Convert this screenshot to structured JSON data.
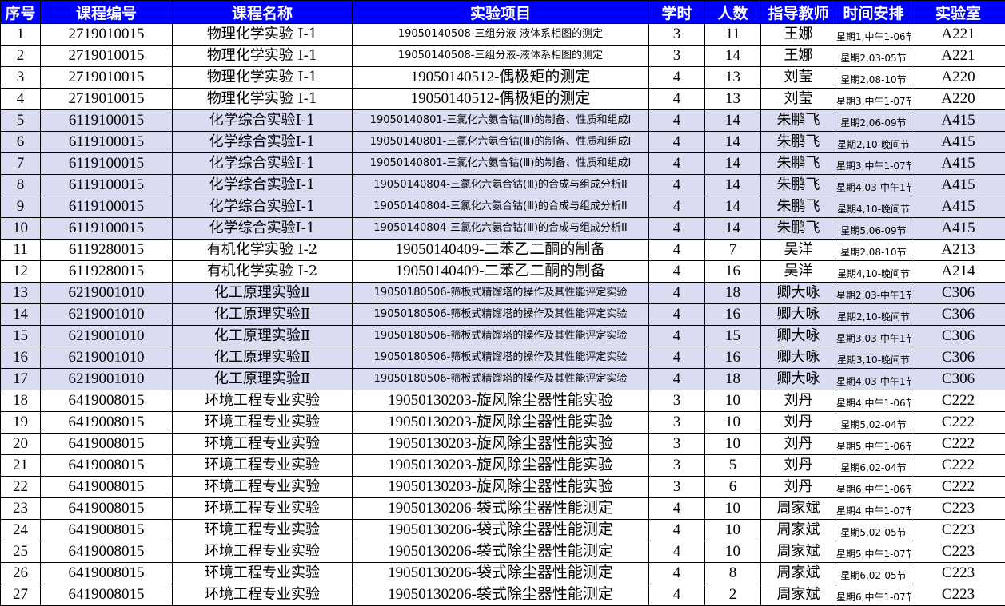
{
  "header": [
    "序号",
    "课程编号",
    "课程名称",
    "实验项目",
    "学时",
    "人数",
    "指导教师",
    "时间安排",
    "实验室"
  ],
  "colors": {
    "header_bg": "#0000ff",
    "header_text": "#ffffff",
    "band": "#dadcf2",
    "grid": "#000000"
  },
  "rows": [
    {
      "no": "1",
      "code": "2719010015",
      "course": "物理化学实验 Ⅰ-1",
      "project": "19050140508-三组分液-液体系相图的测定",
      "hours": "3",
      "count": "11",
      "teacher": "王娜",
      "time": "星期1,中午1-06节",
      "room": "A221",
      "band": false,
      "small": true
    },
    {
      "no": "2",
      "code": "2719010015",
      "course": "物理化学实验 Ⅰ-1",
      "project": "19050140508-三组分液-液体系相图的测定",
      "hours": "3",
      "count": "14",
      "teacher": "王娜",
      "time": "星期2,03-05节",
      "room": "A221",
      "band": false,
      "small": true
    },
    {
      "no": "3",
      "code": "2719010015",
      "course": "物理化学实验 Ⅰ-1",
      "project": "19050140512-偶极矩的测定",
      "hours": "4",
      "count": "13",
      "teacher": "刘莹",
      "time": "星期2,08-10节",
      "room": "A220",
      "band": false,
      "small": false
    },
    {
      "no": "4",
      "code": "2719010015",
      "course": "物理化学实验 Ⅰ-1",
      "project": "19050140512-偶极矩的测定",
      "hours": "4",
      "count": "13",
      "teacher": "刘莹",
      "time": "星期3,中午1-07节",
      "room": "A220",
      "band": false,
      "small": false
    },
    {
      "no": "5",
      "code": "6119100015",
      "course": "化学综合实验Ⅰ-1",
      "project": "19050140801-三氯化六氨合钴(Ⅲ)的制备、性质和组成I",
      "hours": "4",
      "count": "14",
      "teacher": "朱鹏飞",
      "time": "星期2,06-09节",
      "room": "A415",
      "band": true,
      "small": true
    },
    {
      "no": "6",
      "code": "6119100015",
      "course": "化学综合实验Ⅰ-1",
      "project": "19050140801-三氯化六氨合钴(Ⅲ)的制备、性质和组成I",
      "hours": "4",
      "count": "14",
      "teacher": "朱鹏飞",
      "time": "星期2,10-晚间节",
      "room": "A415",
      "band": true,
      "small": true
    },
    {
      "no": "7",
      "code": "6119100015",
      "course": "化学综合实验Ⅰ-1",
      "project": "19050140801-三氯化六氨合钴(Ⅲ)的制备、性质和组成I",
      "hours": "4",
      "count": "14",
      "teacher": "朱鹏飞",
      "time": "星期3,中午1-07节",
      "room": "A415",
      "band": true,
      "small": true
    },
    {
      "no": "8",
      "code": "6119100015",
      "course": "化学综合实验Ⅰ-1",
      "project": "19050140804-三氯化六氨合钴(Ⅲ)的合成与组成分析II",
      "hours": "4",
      "count": "14",
      "teacher": "朱鹏飞",
      "time": "星期4,03-中午1节",
      "room": "A415",
      "band": true,
      "small": true
    },
    {
      "no": "9",
      "code": "6119100015",
      "course": "化学综合实验Ⅰ-1",
      "project": "19050140804-三氯化六氨合钴(Ⅲ)的合成与组成分析II",
      "hours": "4",
      "count": "14",
      "teacher": "朱鹏飞",
      "time": "星期4,10-晚间节",
      "room": "A415",
      "band": true,
      "small": true
    },
    {
      "no": "10",
      "code": "6119100015",
      "course": "化学综合实验Ⅰ-1",
      "project": "19050140804-三氯化六氨合钴(Ⅲ)的合成与组成分析II",
      "hours": "4",
      "count": "14",
      "teacher": "朱鹏飞",
      "time": "星期5,06-09节",
      "room": "A415",
      "band": true,
      "small": true
    },
    {
      "no": "11",
      "code": "6119280015",
      "course": "有机化学实验 Ⅰ-2",
      "project": "19050140409-二苯乙二酮的制备",
      "hours": "4",
      "count": "7",
      "teacher": "吴洋",
      "time": "星期2,08-10节",
      "room": "A213",
      "band": false,
      "small": false
    },
    {
      "no": "12",
      "code": "6119280015",
      "course": "有机化学实验 Ⅰ-2",
      "project": "19050140409-二苯乙二酮的制备",
      "hours": "4",
      "count": "16",
      "teacher": "吴洋",
      "time": "星期4,10-晚间节",
      "room": "A214",
      "band": false,
      "small": false
    },
    {
      "no": "13",
      "code": "6219001010",
      "course": "化工原理实验Ⅱ",
      "project": "19050180506-筛板式精馏塔的操作及其性能评定实验",
      "hours": "4",
      "count": "18",
      "teacher": "卿大咏",
      "time": "星期2,03-中午1节",
      "room": "C306",
      "band": true,
      "small": true
    },
    {
      "no": "14",
      "code": "6219001010",
      "course": "化工原理实验Ⅱ",
      "project": "19050180506-筛板式精馏塔的操作及其性能评定实验",
      "hours": "4",
      "count": "16",
      "teacher": "卿大咏",
      "time": "星期2,10-晚间节",
      "room": "C306",
      "band": true,
      "small": true
    },
    {
      "no": "15",
      "code": "6219001010",
      "course": "化工原理实验Ⅱ",
      "project": "19050180506-筛板式精馏塔的操作及其性能评定实验",
      "hours": "4",
      "count": "15",
      "teacher": "卿大咏",
      "time": "星期3,03-中午1节",
      "room": "C306",
      "band": true,
      "small": true
    },
    {
      "no": "16",
      "code": "6219001010",
      "course": "化工原理实验Ⅱ",
      "project": "19050180506-筛板式精馏塔的操作及其性能评定实验",
      "hours": "4",
      "count": "16",
      "teacher": "卿大咏",
      "time": "星期3,10-晚间节",
      "room": "C306",
      "band": true,
      "small": true
    },
    {
      "no": "17",
      "code": "6219001010",
      "course": "化工原理实验Ⅱ",
      "project": "19050180506-筛板式精馏塔的操作及其性能评定实验",
      "hours": "4",
      "count": "18",
      "teacher": "卿大咏",
      "time": "星期4,03-中午1节",
      "room": "C306",
      "band": true,
      "small": true
    },
    {
      "no": "18",
      "code": "6419008015",
      "course": "环境工程专业实验",
      "project": "19050130203-旋风除尘器性能实验",
      "hours": "3",
      "count": "10",
      "teacher": "刘丹",
      "time": "星期4,中午1-06节",
      "room": "C222",
      "band": false,
      "small": false
    },
    {
      "no": "19",
      "code": "6419008015",
      "course": "环境工程专业实验",
      "project": "19050130203-旋风除尘器性能实验",
      "hours": "3",
      "count": "10",
      "teacher": "刘丹",
      "time": "星期5,02-04节",
      "room": "C222",
      "band": false,
      "small": false
    },
    {
      "no": "20",
      "code": "6419008015",
      "course": "环境工程专业实验",
      "project": "19050130203-旋风除尘器性能实验",
      "hours": "3",
      "count": "10",
      "teacher": "刘丹",
      "time": "星期5,中午1-06节",
      "room": "C222",
      "band": false,
      "small": false
    },
    {
      "no": "21",
      "code": "6419008015",
      "course": "环境工程专业实验",
      "project": "19050130203-旋风除尘器性能实验",
      "hours": "3",
      "count": "5",
      "teacher": "刘丹",
      "time": "星期6,02-04节",
      "room": "C222",
      "band": false,
      "small": false
    },
    {
      "no": "22",
      "code": "6419008015",
      "course": "环境工程专业实验",
      "project": "19050130203-旋风除尘器性能实验",
      "hours": "3",
      "count": "6",
      "teacher": "刘丹",
      "time": "星期6,中午1-06节",
      "room": "C222",
      "band": false,
      "small": false
    },
    {
      "no": "23",
      "code": "6419008015",
      "course": "环境工程专业实验",
      "project": "19050130206-袋式除尘器性能测定",
      "hours": "4",
      "count": "10",
      "teacher": "周家斌",
      "time": "星期4,中午1-07节",
      "room": "C223",
      "band": false,
      "small": false
    },
    {
      "no": "24",
      "code": "6419008015",
      "course": "环境工程专业实验",
      "project": "19050130206-袋式除尘器性能测定",
      "hours": "4",
      "count": "10",
      "teacher": "周家斌",
      "time": "星期5,02-05节",
      "room": "C223",
      "band": false,
      "small": false
    },
    {
      "no": "25",
      "code": "6419008015",
      "course": "环境工程专业实验",
      "project": "19050130206-袋式除尘器性能测定",
      "hours": "4",
      "count": "10",
      "teacher": "周家斌",
      "time": "星期5,中午1-07节",
      "room": "C223",
      "band": false,
      "small": false
    },
    {
      "no": "26",
      "code": "6419008015",
      "course": "环境工程专业实验",
      "project": "19050130206-袋式除尘器性能测定",
      "hours": "4",
      "count": "8",
      "teacher": "周家斌",
      "time": "星期6,02-05节",
      "room": "C223",
      "band": false,
      "small": false
    },
    {
      "no": "27",
      "code": "6419008015",
      "course": "环境工程专业实验",
      "project": "19050130206-袋式除尘器性能测定",
      "hours": "4",
      "count": "2",
      "teacher": "周家斌",
      "time": "星期6,中午1-07节",
      "room": "C223",
      "band": false,
      "small": false
    }
  ]
}
